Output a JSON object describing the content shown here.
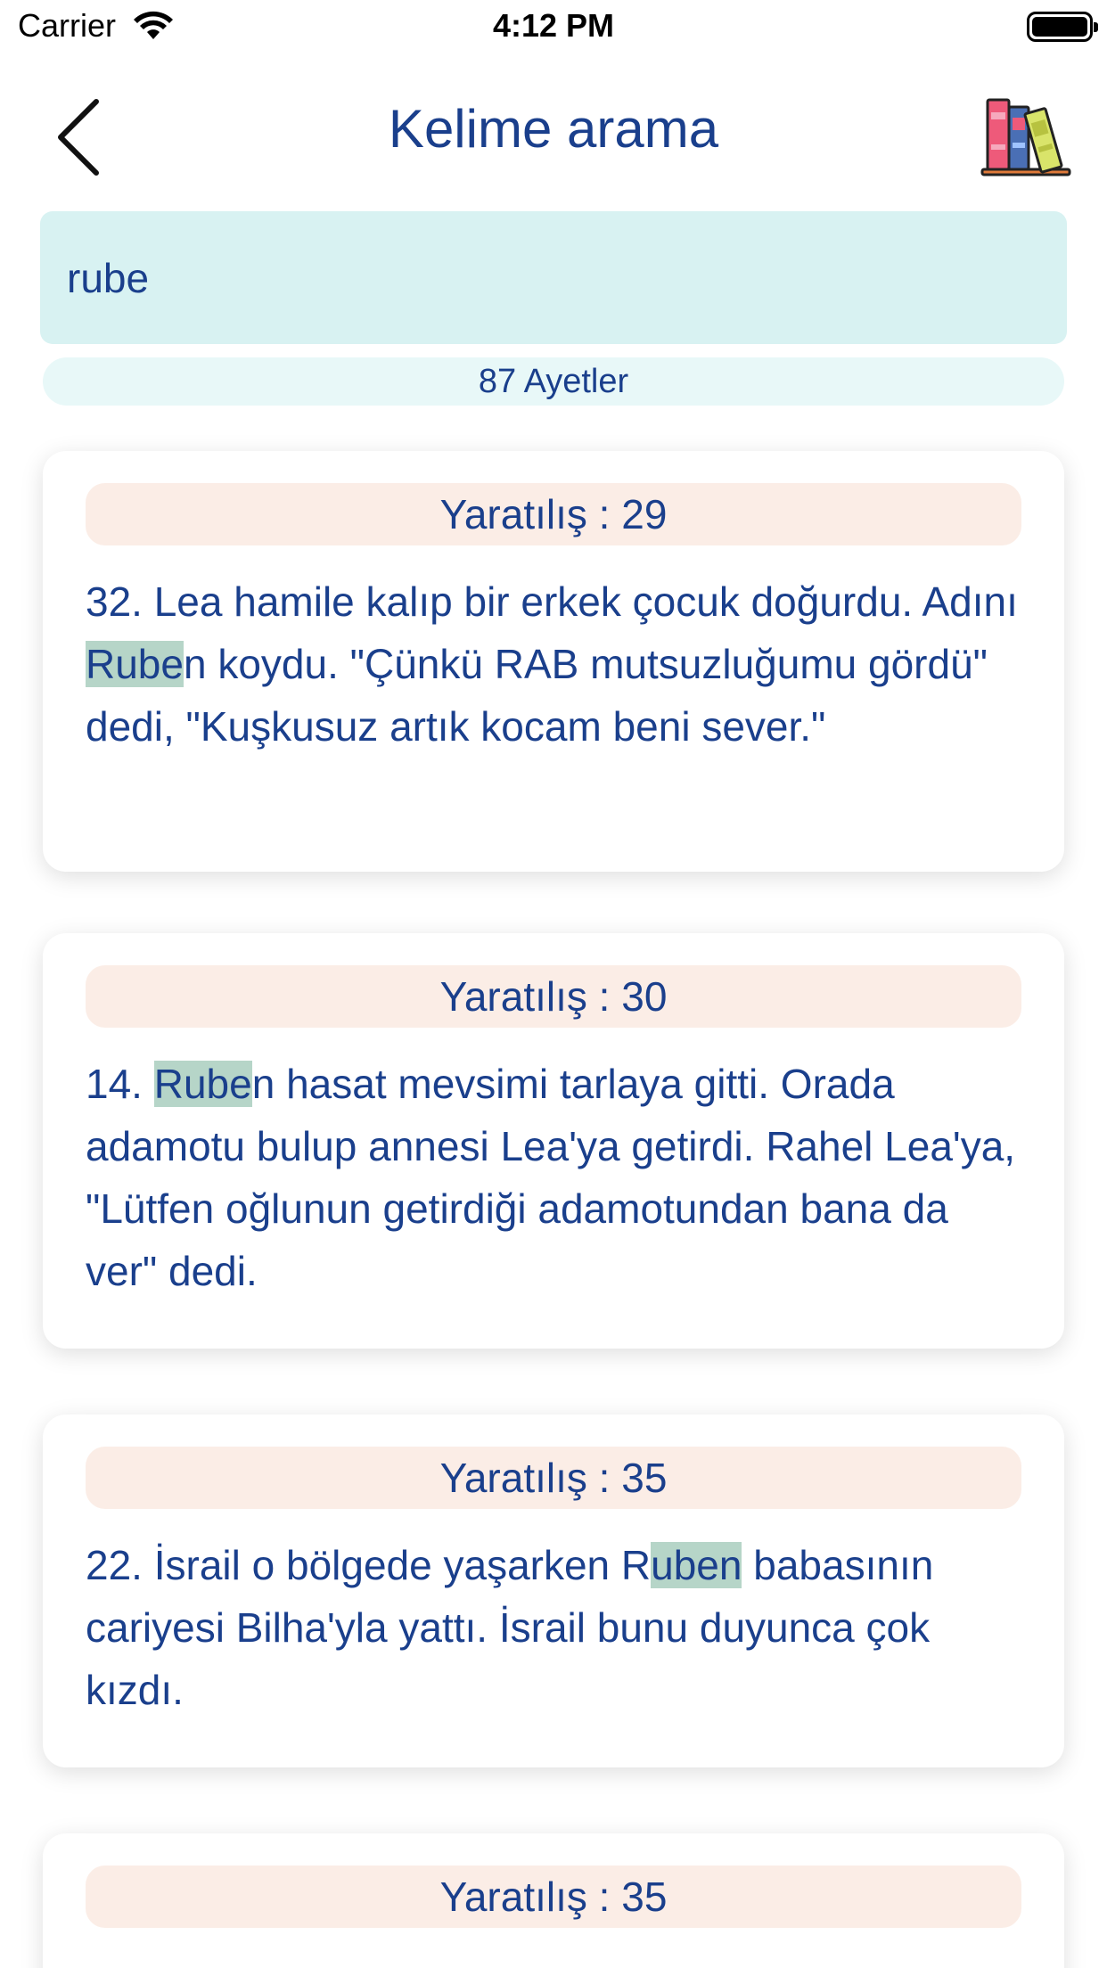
{
  "status_bar": {
    "carrier": "Carrier",
    "time": "4:12 PM"
  },
  "nav": {
    "title": "Kelime arama",
    "back_icon": "chevron-left-icon",
    "books_icon": "books-icon"
  },
  "search": {
    "value": "rube",
    "count": "87 Ayetler"
  },
  "colors": {
    "accent": "#1a3f8c",
    "search_bg": "#d8f2f2",
    "ref_bg": "#fbede6",
    "highlight": "#b6d5c8"
  },
  "results": [
    {
      "ref": "Yaratılış : 29",
      "pre": "32. Lea hamile kalıp bir erkek çocuk doğurdu. Adını ",
      "match": "Rube",
      "post": "n koydu. \"Çünkü RAB mutsuzluğumu gördü\" dedi, \"Kuşkusuz artık kocam beni sever.\""
    },
    {
      "ref": "Yaratılış : 30",
      "pre": "14. ",
      "match": "Rube",
      "post": "n hasat mevsimi tarlaya gitti. Orada adamotu bulup annesi Lea'ya getirdi. Rahel Lea'ya, \"Lütfen oğlunun getirdiği adamotundan bana da ver\" dedi."
    },
    {
      "ref": "Yaratılış : 35",
      "pre": "22. İsrail o bölgede yaşarken R",
      "match": "uben",
      "post": " babasının cariyesi Bilha'yla yattı. İsrail bunu duyunca çok kızdı."
    },
    {
      "ref": "Yaratılış : 35",
      "pre": "",
      "match": "",
      "post": ""
    }
  ]
}
